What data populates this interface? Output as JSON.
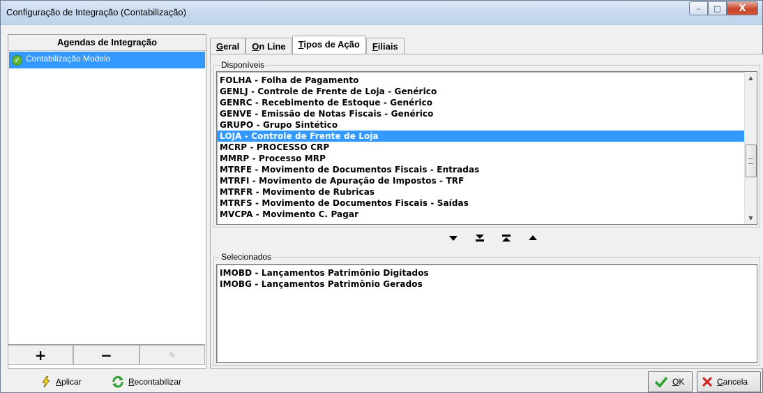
{
  "window": {
    "title": "Configuração de Integração (Contabilização)",
    "controls": {
      "minimize": "–",
      "maximize": "□",
      "close": "X"
    }
  },
  "left": {
    "header": "Agendas de Integração",
    "items": [
      {
        "label": "Contabilização Modelo",
        "icon": "check-circle-icon",
        "selected": true
      }
    ],
    "buttons": {
      "add": "+",
      "remove": "−",
      "edit": "✎"
    }
  },
  "tabs": [
    {
      "label": "Geral",
      "hotkey": "G",
      "rest": "eral",
      "active": false
    },
    {
      "label": "On Line",
      "hotkey": "O",
      "rest": "n Line",
      "active": false
    },
    {
      "label": "Tipos de Ação",
      "hotkey": "T",
      "rest": "ipos de Ação",
      "active": true
    },
    {
      "label": "Filiais",
      "hotkey": "F",
      "rest": "iliais",
      "active": false
    }
  ],
  "disponiveis": {
    "label": "Disponíveis",
    "items": [
      "FOLHA - Folha de Pagamento",
      "GENLJ - Controle de Frente de Loja - Genérico",
      "GENRC - Recebimento de Estoque - Genérico",
      "GENVE - Emissão de Notas Fiscais - Genérico",
      "GRUPO - Grupo Sintético",
      "LOJA - Controle de Frente de Loja",
      "MCRP - PROCESSO CRP",
      "MMRP - Processo MRP",
      "MTRFE - Movimento de Documentos Fiscais - Entradas",
      "MTRFI - Movimento de Apuração de Impostos - TRF",
      "MTRFR - Movimento de Rubricas",
      "MTRFS - Movimento de Documentos Fiscais - Saídas",
      "MVCPA - Movimento C. Pagar"
    ],
    "selected_index": 5
  },
  "selecionados": {
    "label": "Selecionados",
    "items": [
      "IMOBD - Lançamentos Patrimônio Digitados",
      "IMOBG - Lançamentos Patrimônio Gerados"
    ]
  },
  "bottom": {
    "aplicar": {
      "hotkey": "A",
      "rest": "plicar"
    },
    "recontabilizar": {
      "hotkey": "R",
      "rest": "econtabilizar"
    },
    "ok": {
      "hotkey": "O",
      "rest": "K"
    },
    "cancela": {
      "hotkey": "C",
      "rest": "ancela"
    }
  },
  "colors": {
    "selection": "#3399ff",
    "ok_green": "#2ca02c",
    "cancel_red": "#d0201a"
  }
}
